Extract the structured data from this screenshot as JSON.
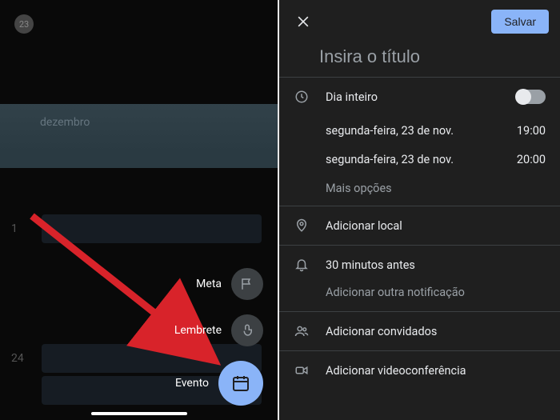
{
  "left": {
    "day_badge": "23",
    "month_label": "dezembro",
    "dim_rows": [
      1,
      24
    ],
    "fab_items": [
      {
        "label": "Meta",
        "icon": "flag-icon"
      },
      {
        "label": "Lembrete",
        "icon": "tap-icon"
      },
      {
        "label": "Evento",
        "icon": "calendar-icon"
      }
    ]
  },
  "right": {
    "title_placeholder": "Insira o título",
    "save_label": "Salvar",
    "allday_label": "Dia inteiro",
    "start": {
      "date": "segunda-feira, 23 de nov.",
      "time": "19:00"
    },
    "end": {
      "date": "segunda-feira, 23 de nov.",
      "time": "20:00"
    },
    "more_options": "Mais opções",
    "location_label": "Adicionar local",
    "reminder_label": "30 minutos antes",
    "add_notification_label": "Adicionar outra notificação",
    "guests_label": "Adicionar convidados",
    "video_label": "Adicionar videoconferência"
  },
  "colors": {
    "accent": "#8ab4f8",
    "arrow": "#d8232a"
  }
}
